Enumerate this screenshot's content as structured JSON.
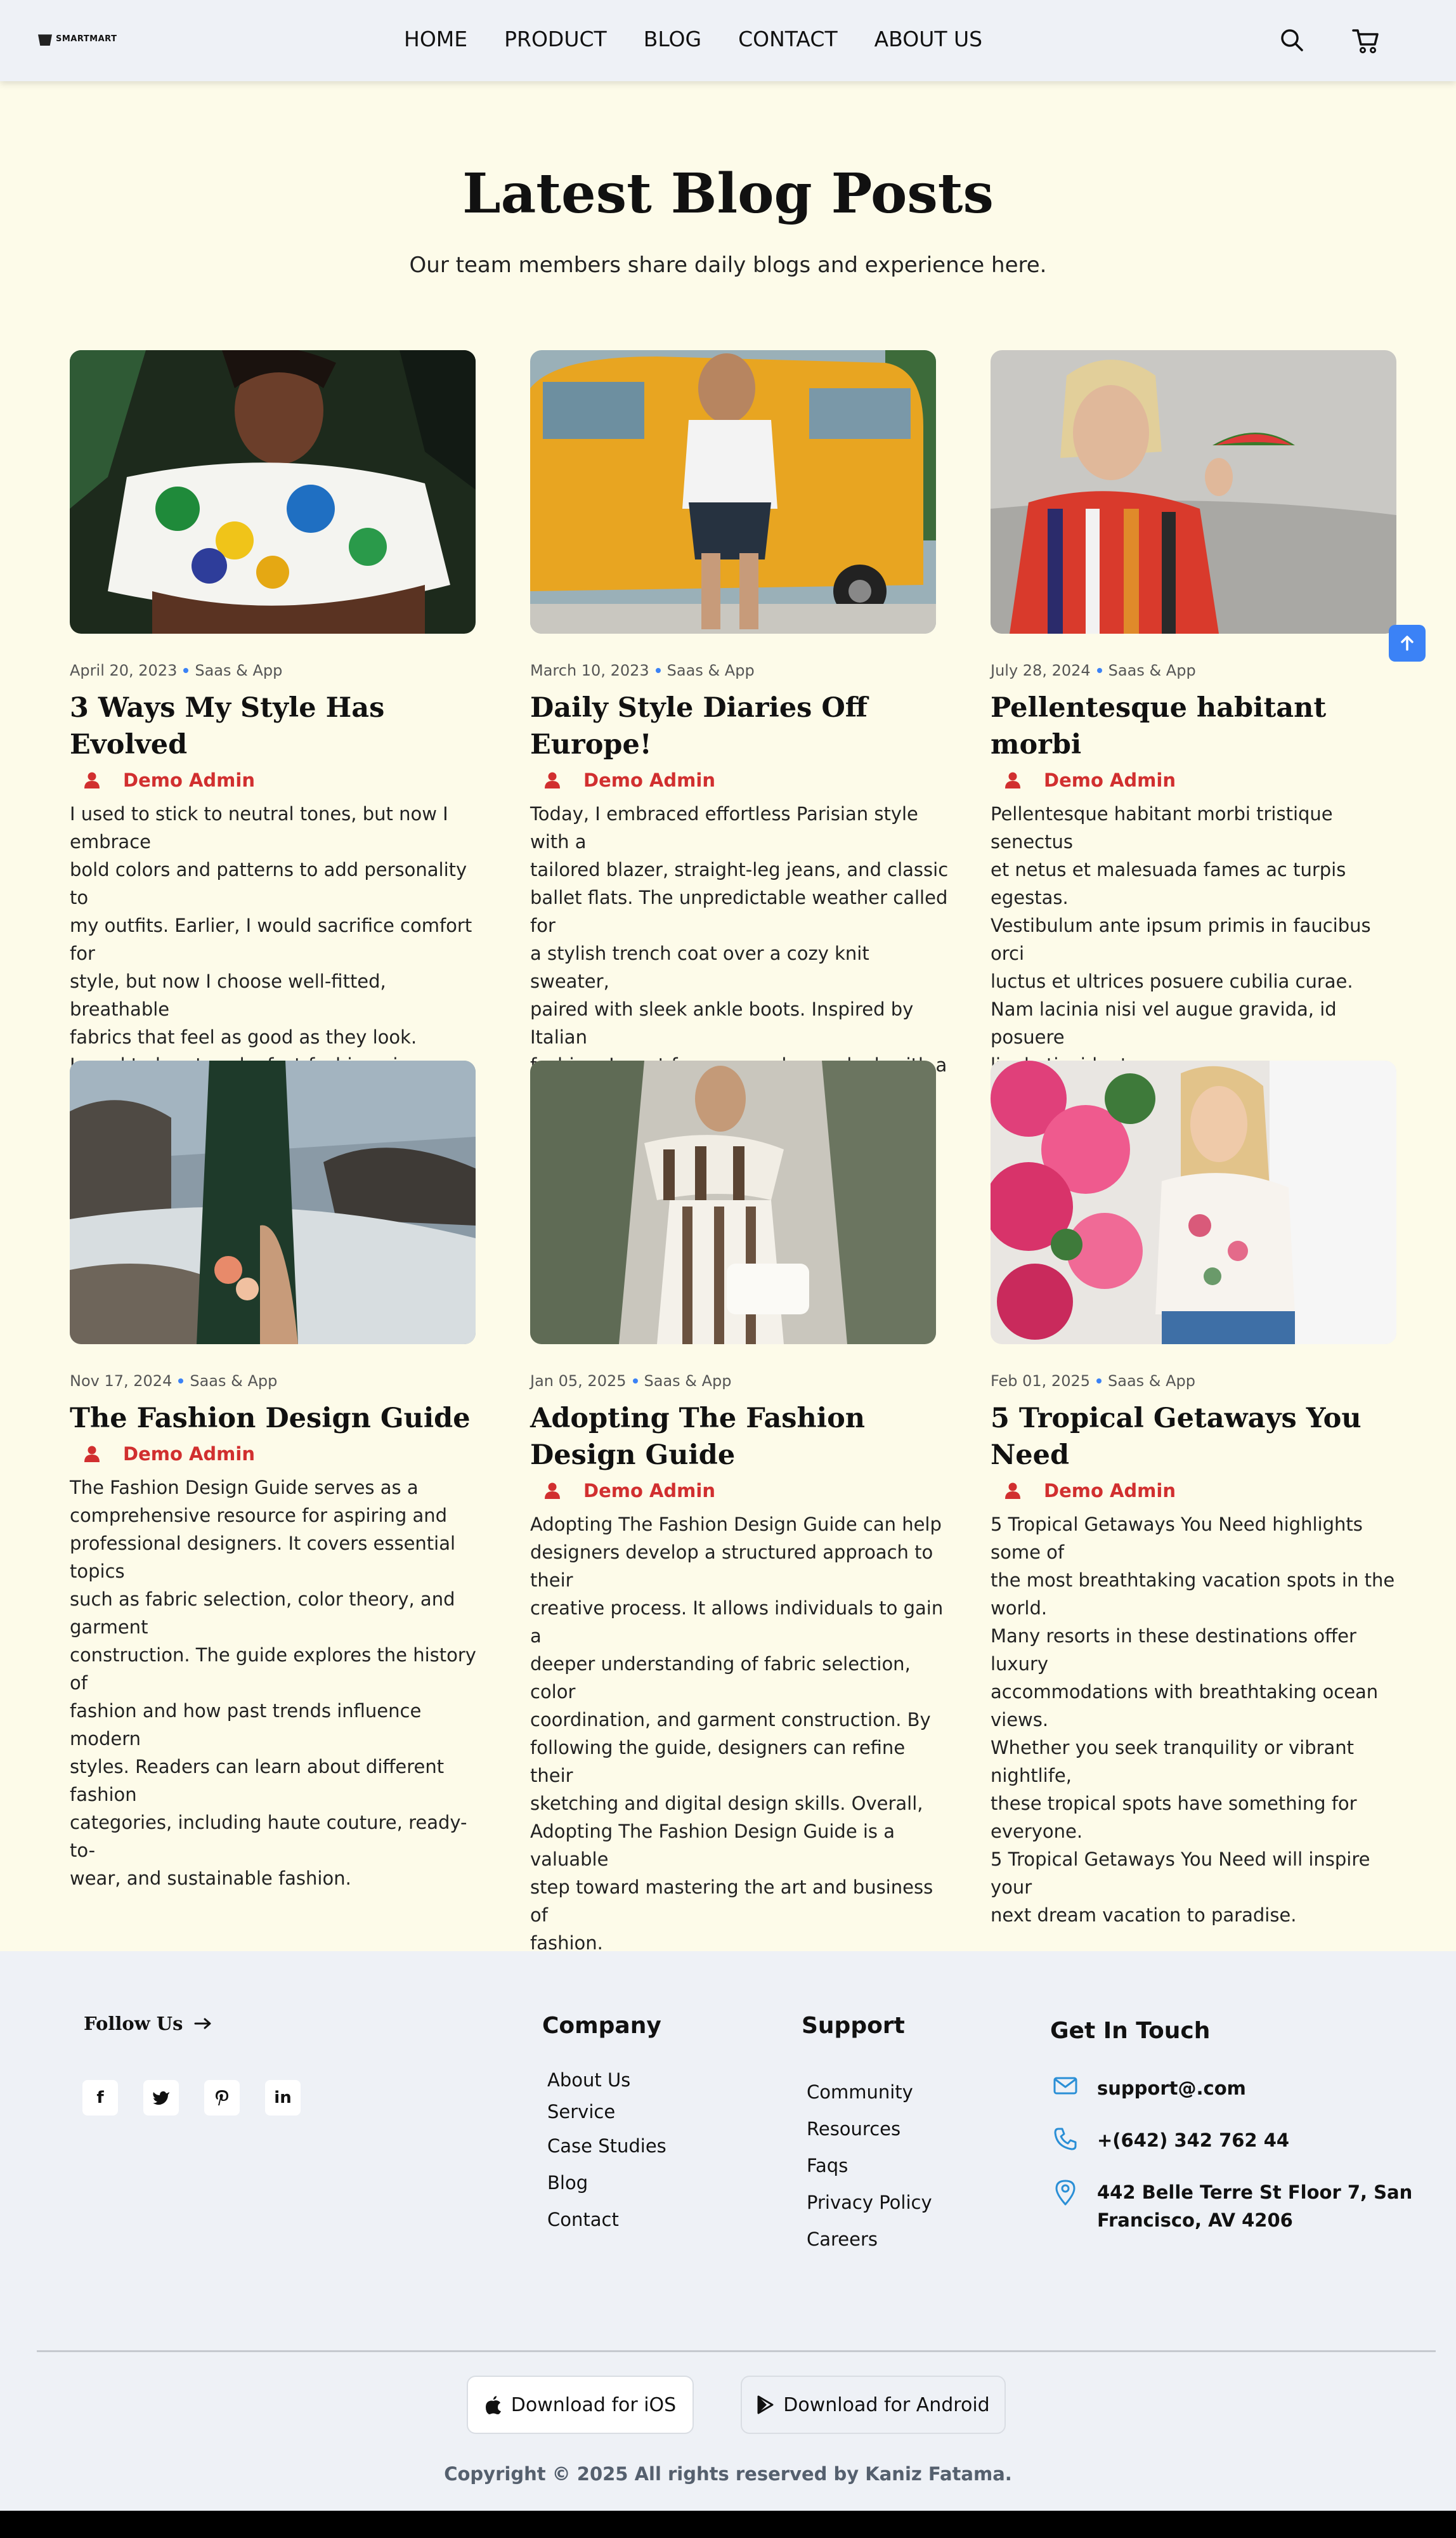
{
  "brand": {
    "name": "SMARTMART"
  },
  "nav": {
    "items": [
      "HOME",
      "PRODUCT",
      "BLOG",
      "CONTACT",
      "ABOUT US"
    ]
  },
  "hero": {
    "title": "Latest Blog Posts",
    "subtitle": "Our team members share daily blogs and experience here."
  },
  "posts": [
    {
      "date": "April 20, 2023",
      "category": "Saas & App",
      "title": "3 Ways My Style Has Evolved",
      "author": "Demo Admin",
      "body": "I used to stick to neutral tones, but now I embrace\nbold colors and patterns to add personality to\nmy outfits. Earlier, I would sacrifice comfort for\nstyle, but now I choose well-fitted, breathable\nfabrics that feel as good as they look.\nI used to buy trendy, fast-fashion pieces,\nbut now I focus on timeless, high-quality\nstaples that last longer."
    },
    {
      "date": "March 10, 2023",
      "category": "Saas & App",
      "title": "Daily Style Diaries Off Europe!",
      "author": "Demo Admin",
      "body": "Today, I embraced effortless Parisian style with a\ntailored blazer, straight-leg jeans, and classic\nballet flats. The unpredictable weather called for\na stylish trench coat over a cozy knit sweater,\npaired with sleek ankle boots. Inspired by Italian\nfashion, I went for a monochrome look with a\nfitted midi dress, gold accessories, and pointed\nheels."
    },
    {
      "date": "July 28, 2024",
      "category": "Saas & App",
      "title": "Pellentesque habitant morbi",
      "author": "Demo Admin",
      "body": "Pellentesque habitant morbi tristique senectus\net netus et malesuada fames ac turpis egestas.\nVestibulum ante ipsum primis in faucibus orci\nluctus et ultrices posuere cubilia curae.\nNam lacinia nisi vel augue gravida, id posuere\nligula tincidunt."
    },
    {
      "date": "Nov 17, 2024",
      "category": "Saas & App",
      "title": "The Fashion Design Guide",
      "author": "Demo Admin",
      "body": "The Fashion Design Guide serves as a\ncomprehensive resource for aspiring and\nprofessional designers. It covers essential topics\nsuch as fabric selection, color theory, and garment\nconstruction. The guide explores the history of\nfashion and how past trends influence modern\nstyles. Readers can learn about different fashion\ncategories, including haute couture, ready-to-\nwear, and sustainable fashion."
    },
    {
      "date": "Jan 05, 2025",
      "category": "Saas & App",
      "title": "Adopting The Fashion Design Guide",
      "author": "Demo Admin",
      "body": "Adopting The Fashion Design Guide can help\ndesigners develop a structured approach to their\ncreative process. It allows individuals to gain a\ndeeper understanding of fabric selection, color\ncoordination, and garment construction. By\nfollowing the guide, designers can refine their\nsketching and digital design skills. Overall,\nAdopting The Fashion Design Guide is a valuable\nstep toward mastering the art and business of\nfashion."
    },
    {
      "date": "Feb 01, 2025",
      "category": "Saas & App",
      "title": "5 Tropical Getaways You Need",
      "author": "Demo Admin",
      "body": "5 Tropical Getaways You Need highlights some of\nthe most breathtaking vacation spots in the world.\nMany resorts in these destinations offer luxury\naccommodations with breathtaking ocean views.\nWhether you seek tranquility or vibrant nightlife,\nthese tropical spots have something for everyone.\n5 Tropical Getaways You Need will inspire your\nnext dream vacation to paradise."
    }
  ],
  "footer": {
    "follow": "Follow Us",
    "socials": [
      "f",
      "t",
      "p",
      "in"
    ],
    "company": {
      "title": "Company",
      "links": [
        "About Us",
        "Service",
        "Case Studies",
        "Blog",
        "Contact"
      ]
    },
    "support": {
      "title": "Support",
      "links": [
        "Community",
        "Resources",
        "Faqs",
        "Privacy Policy",
        "Careers"
      ]
    },
    "contact": {
      "title": "Get In Touch",
      "email": "support@.com",
      "phone": "+(642) 342 762 44",
      "address": "442 Belle Terre St Floor 7, San\nFrancisco, AV 4206"
    },
    "ios": "Download for iOS",
    "android": "Download for Android",
    "copyright": "Copyright © 2025 All rights reserved by Kaniz Fatama."
  },
  "colors": {
    "accent": "#3b82f6",
    "author": "#d12f2f",
    "page_bg": "#fdfbe9",
    "footer_bg": "#eef1f6"
  }
}
